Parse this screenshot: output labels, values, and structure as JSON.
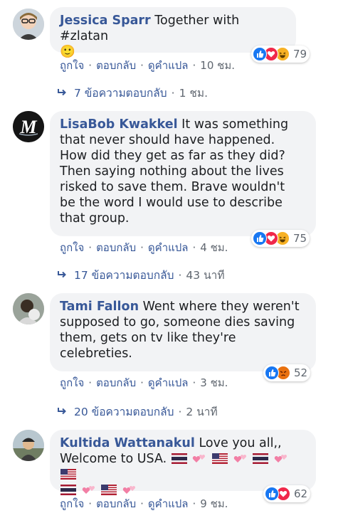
{
  "actions": {
    "like": "ถูกใจ",
    "reply": "ตอบกลับ",
    "translate": "ดูคำแปล",
    "sep": "·"
  },
  "comments": [
    {
      "author": "Jessica Sparr",
      "text_lines": [
        "Together with #zlatan"
      ],
      "emoji_line": "🙂",
      "time": "10 ชม.",
      "reactions": [
        "like-icon",
        "love-icon",
        "haha-icon"
      ],
      "reaction_count": "79",
      "replies_count": "7 ข้อความตอบกลับ",
      "replies_time": "1 ชม."
    },
    {
      "author": "LisaBob Kwakkel",
      "text_lines": [
        "It was something",
        "that never should have happened.",
        "How did they get as far as they did?",
        "Then saying nothing about the lives",
        "risked to save them. Brave wouldn't",
        "be the word I would use to describe",
        "that group."
      ],
      "time": "4 ชม.",
      "reactions": [
        "like-icon",
        "love-icon",
        "haha-icon"
      ],
      "reaction_count": "75",
      "replies_count": "17 ข้อความตอบกลับ",
      "replies_time": "43 นาที"
    },
    {
      "author": "Tami Fallon",
      "text_lines": [
        "Went where they weren't",
        "supposed to go, someone dies saving",
        "them, gets on tv like they're",
        "celebreties."
      ],
      "time": "3 ชม.",
      "reactions": [
        "like-icon",
        "angry-icon"
      ],
      "reaction_count": "52",
      "replies_count": "20 ข้อความตอบกลับ",
      "replies_time": "2 นาที"
    },
    {
      "author": "Kultida Wattanakul",
      "text_lines": [
        "Love you all,,",
        "Welcome to USA."
      ],
      "time": "9 ชม.",
      "reactions": [
        "like-icon",
        "love-icon"
      ],
      "reaction_count": "62"
    }
  ],
  "colors": {
    "link": "#385898",
    "meta": "#606770",
    "bubble": "#f2f3f5",
    "like": "#1877f2",
    "love": "#f0284a",
    "haha": "#f7b125",
    "angry": "#e9710f"
  }
}
